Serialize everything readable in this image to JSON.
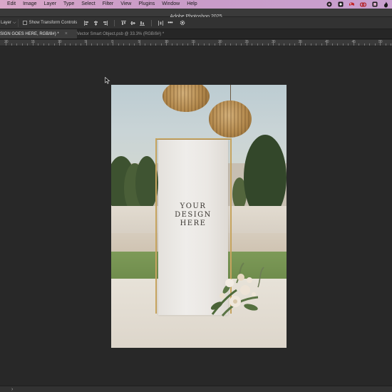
{
  "menubar": {
    "items": [
      "Edit",
      "Image",
      "Layer",
      "Type",
      "Select",
      "Filter",
      "View",
      "Plugins",
      "Window",
      "Help"
    ],
    "status_icons": [
      "record-icon",
      "app-icon",
      "gamepad-icon",
      "creative-cloud-icon",
      "menu-extra-icon",
      "flame-icon"
    ]
  },
  "app": {
    "title": "Adobe Photoshop 2025"
  },
  "options": {
    "layer_select": "Layer",
    "show_transform_label": "Show Transform Controls",
    "more_label": "•••"
  },
  "tabs": [
    {
      "label": "SIGN GOES HERE, RGB/8#) *",
      "active": true
    },
    {
      "label": "Vector Smart Object.psb @ 33.3% (RGB/8#) *",
      "active": false
    }
  ],
  "ruler": {
    "labels": [
      "20",
      "15",
      "10",
      "5",
      "0",
      "5",
      "10",
      "15",
      "20",
      "25",
      "30",
      "35",
      "40",
      "45",
      "50"
    ]
  },
  "document": {
    "banner_text": "YOUR\nDESIGN\nHERE"
  },
  "statusbar": {
    "chevron": "›"
  },
  "colors": {
    "menubar": "#d9a7c9",
    "workspace": "#282828",
    "panel": "#323232",
    "gold_frame": "#c9a45e",
    "lawn": "#7d9a58"
  }
}
